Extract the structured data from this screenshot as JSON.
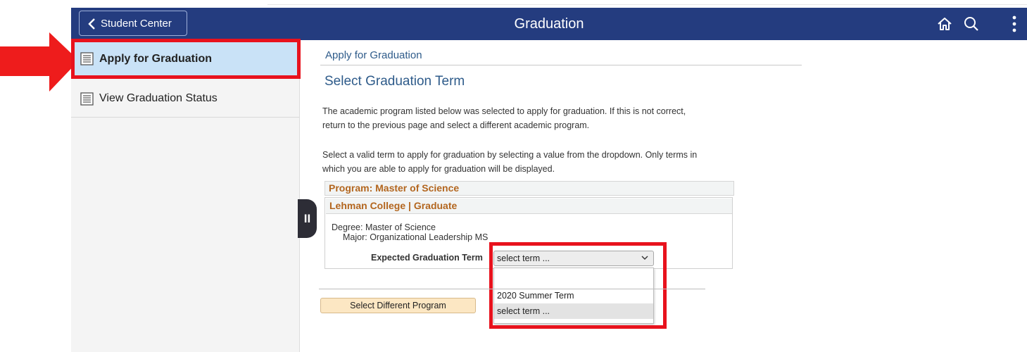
{
  "header": {
    "back_label": "Student Center",
    "title": "Graduation",
    "color": "#243c7f"
  },
  "icons": {
    "back": "chevron-left-icon",
    "home": "home-icon",
    "search": "search-icon",
    "menu": "more-vertical-icon",
    "doc": "document-icon",
    "collapse": "pause-bars-icon"
  },
  "sidebar": {
    "items": [
      {
        "label": "Apply for Graduation"
      },
      {
        "label": "View Graduation Status"
      }
    ]
  },
  "main": {
    "breadcrumb": "Apply for Graduation",
    "title": "Select Graduation Term",
    "para1_line1": "The academic program listed below was selected to apply for graduation. If this is not correct,",
    "para1_line2": "return to the previous page and select a different academic program.",
    "para2_line1": "Select a valid term to apply for graduation by selecting a value from the dropdown. Only terms in",
    "para2_line2": "which you are able to apply for graduation will be displayed.",
    "program": "Program: Master of Science",
    "college": "Lehman College | Graduate",
    "degree": "Degree: Master of Science",
    "major": "Major: Organizational Leadership MS",
    "term_label": "Expected Graduation Term",
    "term_value": "select term ...",
    "dropdown_options": [
      "",
      "2020 Summer Term",
      "select term ..."
    ],
    "button": "Select Different Program"
  },
  "collapse_symbol": "II",
  "annotation_color": "#e8121d"
}
